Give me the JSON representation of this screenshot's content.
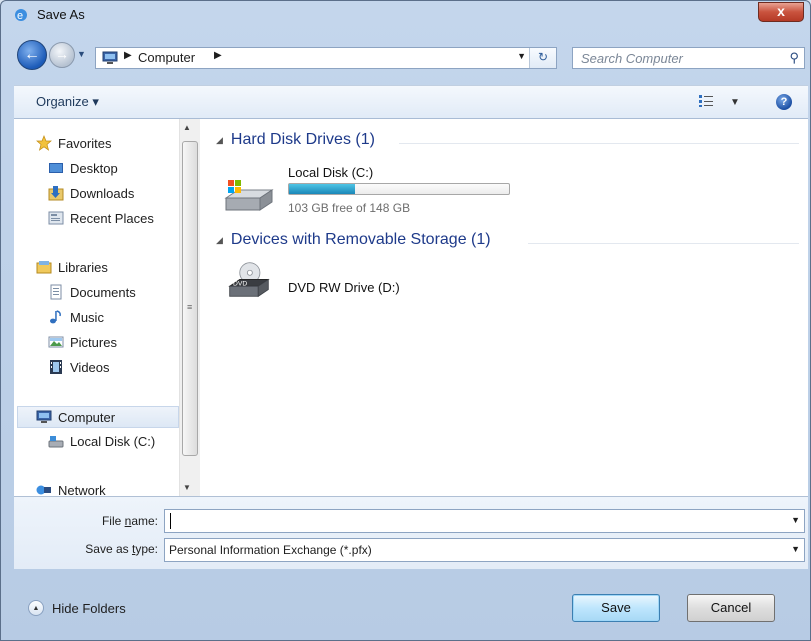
{
  "window": {
    "title": "Save As",
    "close_label": "x"
  },
  "navigation": {
    "address_segment": "Computer",
    "search_placeholder": "Search Computer"
  },
  "toolbar": {
    "organize_label": "Organize ▾",
    "help_label": "?"
  },
  "sidebar": {
    "favorites": {
      "label": "Favorites",
      "items": [
        "Desktop",
        "Downloads",
        "Recent Places"
      ]
    },
    "libraries": {
      "label": "Libraries",
      "items": [
        "Documents",
        "Music",
        "Pictures",
        "Videos"
      ]
    },
    "computer": {
      "label": "Computer",
      "items": [
        "Local Disk (C:)"
      ]
    },
    "network": {
      "label": "Network"
    }
  },
  "main": {
    "hard_disk_group": "Hard Disk Drives (1)",
    "local_disk": {
      "name": "Local Disk (C:)",
      "free_text": "103 GB free of 148 GB",
      "used_fraction": 0.3
    },
    "removable_group": "Devices with Removable Storage (1)",
    "dvd_drive": {
      "name": "DVD RW Drive (D:)",
      "icon_text": "DVD"
    }
  },
  "form": {
    "filename_label_pre": "File ",
    "filename_label_u": "n",
    "filename_label_post": "ame:",
    "filename_value": "",
    "savetype_label_pre": "Save as ",
    "savetype_label_u": "t",
    "savetype_label_post": "ype:",
    "savetype_value": "Personal Information Exchange (*.pfx)"
  },
  "footer": {
    "hide_folders_label": "Hide Folders",
    "save_label": "Save",
    "cancel_label": "Cancel"
  },
  "colors": {
    "accent_blue": "#1e3a8a",
    "progress_fill": "#1a87b8"
  }
}
